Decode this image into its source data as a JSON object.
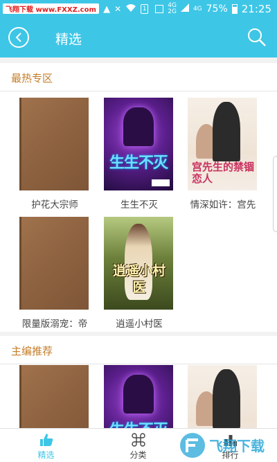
{
  "status_bar": {
    "watermark_text": "飞翔下载 www.FXXZ.com",
    "network_top": "4G",
    "network_bottom": "2G",
    "network_top2": "4G",
    "battery_percent": "75%",
    "time": "21:25"
  },
  "app_bar": {
    "title": "精选"
  },
  "sections": [
    {
      "title": "最热专区",
      "books": [
        {
          "title": "护花大宗师",
          "cover_style": "plain-brown"
        },
        {
          "title": "生生不灭",
          "cover_style": "fantasy-purple",
          "cover_text": "生生不灭"
        },
        {
          "title": "情深如许：宫先",
          "cover_style": "romance-pink",
          "cover_text": "宫先生的禁锢恋人"
        },
        {
          "title": "限量版溺宠：帝",
          "cover_style": "plain-brown"
        },
        {
          "title": "逍遥小村医",
          "cover_style": "rural-green",
          "cover_text": "逍遥小村医"
        }
      ]
    },
    {
      "title": "主编推荐",
      "books": [
        {
          "title": "",
          "cover_style": "plain-brown"
        },
        {
          "title": "",
          "cover_style": "fantasy-purple",
          "cover_text": "生生不灭"
        },
        {
          "title": "",
          "cover_style": "romance-pink"
        }
      ]
    }
  ],
  "tab_bar": {
    "tabs": [
      {
        "label": "精选",
        "icon": "thumbs-up-icon",
        "active": true
      },
      {
        "label": "分类",
        "icon": "command-icon",
        "active": false
      },
      {
        "label": "排行",
        "icon": "ranking-icon",
        "active": false
      }
    ]
  },
  "colors": {
    "accent": "#3ec6e6",
    "section_title": "#c47d2a",
    "background": "#f2f2f2"
  },
  "watermark_logo_text": "飞翔下载"
}
